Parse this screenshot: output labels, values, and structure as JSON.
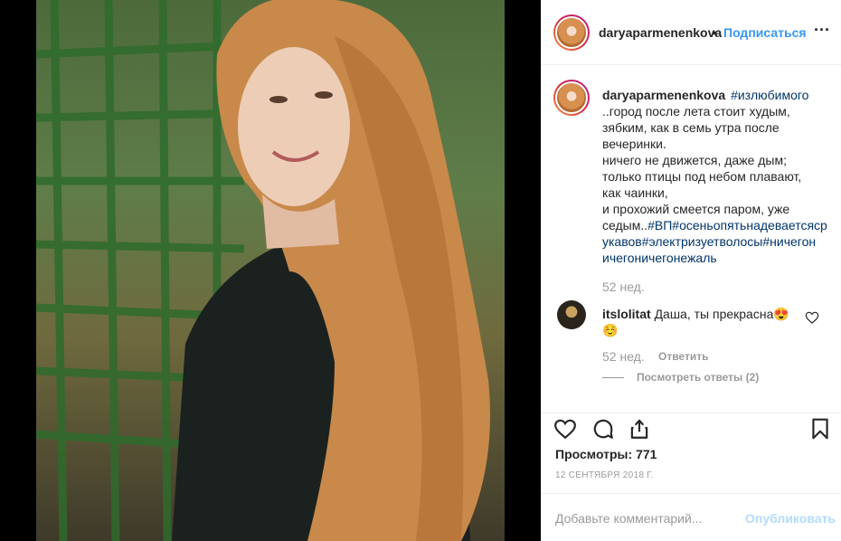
{
  "post": {
    "username": "daryaparmenenkova",
    "separator": "•",
    "follow_label": "Подписаться",
    "more_icon": "more-options-icon",
    "more_glyph": "···"
  },
  "caption": {
    "username": "daryaparmenenkova",
    "hashtag_intro": "#излюбимого",
    "body": "..город после лета стоит худым,\nзябким, как в семь утра после\nвечеринки.\nничего не движется, даже дым;\nтолько птицы под небом плавают,\nкак чаинки,\nи прохожий смеется паром, уже\nседым..",
    "hashtags_tail": "#ВП#осеньопятьнадеваетсяср\nукавов#электризуетволосы#ничегон\nичегоничегонежаль",
    "time": "52 нед."
  },
  "comment": {
    "username": "itslolitat",
    "text": "Даша, ты прекрасна😍\n☺️",
    "time": "52 нед.",
    "reply_label": "Ответить",
    "view_replies_label": "Посмотреть ответы (2)"
  },
  "stats": {
    "views_label": "Просмотры:",
    "views_count": "771",
    "date": "12 сентября 2018 г."
  },
  "add_comment": {
    "placeholder": "Добавьте комментарий...",
    "publish_label": "Опубликовать"
  },
  "colors": {
    "accent": "#3897f0",
    "publish_disabled": "#b3dbff",
    "muted": "#999999",
    "text": "#262626",
    "hashtag": "#003569"
  }
}
